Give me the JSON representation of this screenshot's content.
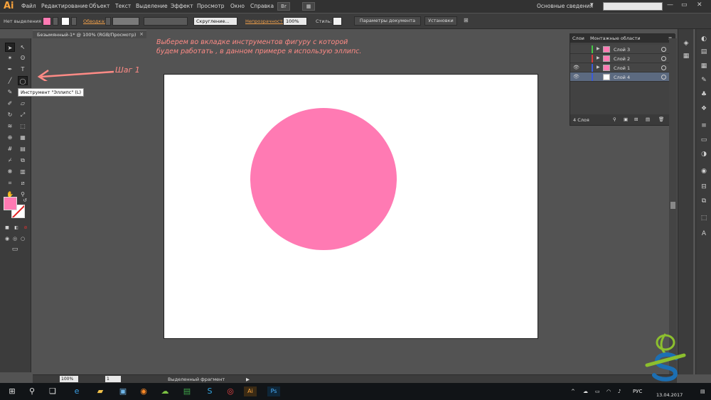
{
  "app": {
    "logo": "Ai",
    "menu": [
      "Файл",
      "Редактирование",
      "Объект",
      "Текст",
      "Выделение",
      "Эффект",
      "Просмотр",
      "Окно",
      "Справка"
    ],
    "workspace": "Основные сведения",
    "search_placeholder": ""
  },
  "control_bar": {
    "selection_label": "Нет выделения",
    "stroke_label": "Обводка:",
    "brush_label": "Скругление...",
    "opacity_label": "Непрозрачность:",
    "opacity_value": "100%",
    "style_label": "Стиль:",
    "doc_settings_button": "Параметры документа",
    "prefs_button": "Установки",
    "fill_color": "#ff7ab3"
  },
  "document": {
    "tab_title": "Безымянный-1* @ 100% (RGB/Просмотр)",
    "tab_close": "×"
  },
  "tools": {
    "tooltip": "Инструмент \"Эллипс\" (L)"
  },
  "annotation": {
    "text": "Выберем во вкладке инструментов фигуру с которой будем работать , в данном примере я использую эллипс.",
    "step": "Шаг 1",
    "color": "#ff8b86"
  },
  "canvas": {
    "shape": "ellipse",
    "shape_color": "#ff7ab3"
  },
  "layers_panel": {
    "tabs": [
      "Слои",
      "Монтажные области"
    ],
    "rows": [
      {
        "name": "Слой 3",
        "color": "#45c845",
        "eye": "",
        "thumb": "pink"
      },
      {
        "name": "Слой 2",
        "color": "#d83a3a",
        "eye": "",
        "thumb": "pink"
      },
      {
        "name": "Слой 1",
        "color": "#3b5bd8",
        "eye": "👁",
        "thumb": "pink"
      },
      {
        "name": "Слой 4",
        "color": "#3b5bd8",
        "eye": "👁",
        "thumb": "white"
      }
    ],
    "count": "4 Слоя"
  },
  "status_bar": {
    "zoom": "100%",
    "page": "1",
    "info": "Выделенный фрагмент"
  },
  "taskbar": {
    "language": "РУС",
    "date": "13.04.2017",
    "ai_label": "Ai",
    "ps_label": "Ps"
  }
}
